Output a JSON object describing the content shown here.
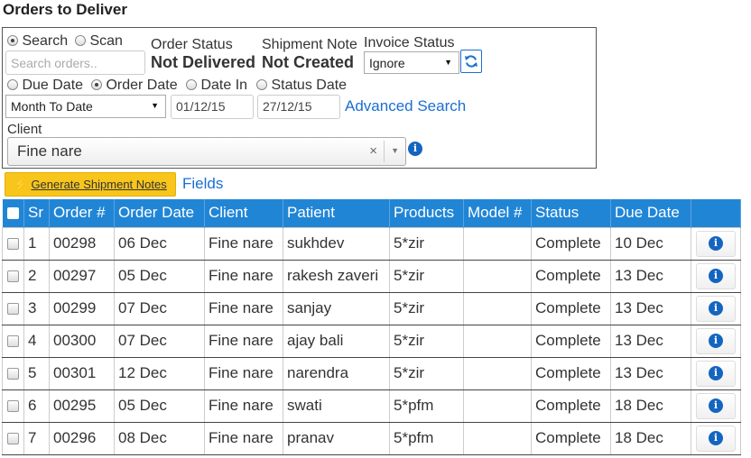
{
  "page": {
    "title": "Orders to Deliver"
  },
  "search_mode": {
    "search_label": "Search",
    "scan_label": "Scan",
    "selected": "search"
  },
  "search": {
    "placeholder": "Search orders..",
    "value": ""
  },
  "order_status": {
    "label": "Order Status",
    "value": "Not Delivered"
  },
  "shipment_note": {
    "label": "Shipment Note",
    "value": "Not Created"
  },
  "invoice_status": {
    "label": "Invoice Status",
    "selected": "Ignore"
  },
  "date_type": {
    "options": [
      "Due Date",
      "Order Date",
      "Date In",
      "Status Date"
    ],
    "selected": "Order Date",
    "labels": {
      "due": "Due Date",
      "order": "Order Date",
      "in": "Date In",
      "status": "Status Date"
    }
  },
  "date_range": {
    "selected": "Month To Date",
    "from": "01/12/15",
    "to": "27/12/15"
  },
  "advanced_search_label": "Advanced Search",
  "client": {
    "label": "Client",
    "value": "Fine nare"
  },
  "toolbar": {
    "generate_label": "Generate Shipment Notes",
    "fields_label": "Fields"
  },
  "table": {
    "columns": [
      "Sr",
      "Order #",
      "Order Date",
      "Client",
      "Patient",
      "Products",
      "Model #",
      "Status",
      "Due Date"
    ],
    "rows": [
      {
        "sr": "1",
        "order": "00298",
        "order_date": "06 Dec",
        "client": "Fine nare",
        "patient": "sukhdev",
        "products": "5*zir",
        "model": "",
        "status": "Complete",
        "due": "10 Dec"
      },
      {
        "sr": "2",
        "order": "00297",
        "order_date": "05 Dec",
        "client": "Fine nare",
        "patient": "rakesh zaveri",
        "products": "5*zir",
        "model": "",
        "status": "Complete",
        "due": "13 Dec"
      },
      {
        "sr": "3",
        "order": "00299",
        "order_date": "07 Dec",
        "client": "Fine nare",
        "patient": "sanjay",
        "products": "5*zir",
        "model": "",
        "status": "Complete",
        "due": "13 Dec"
      },
      {
        "sr": "4",
        "order": "00300",
        "order_date": "07 Dec",
        "client": "Fine nare",
        "patient": "ajay bali",
        "products": "5*zir",
        "model": "",
        "status": "Complete",
        "due": "13 Dec"
      },
      {
        "sr": "5",
        "order": "00301",
        "order_date": "12 Dec",
        "client": "Fine nare",
        "patient": "narendra",
        "products": "5*zir",
        "model": "",
        "status": "Complete",
        "due": "13 Dec"
      },
      {
        "sr": "6",
        "order": "00295",
        "order_date": "05 Dec",
        "client": "Fine nare",
        "patient": "swati",
        "products": "5*pfm",
        "model": "",
        "status": "Complete",
        "due": "18 Dec"
      },
      {
        "sr": "7",
        "order": "00296",
        "order_date": "08 Dec",
        "client": "Fine nare",
        "patient": "pranav",
        "products": "5*pfm",
        "model": "",
        "status": "Complete",
        "due": "18 Dec"
      }
    ]
  },
  "colors": {
    "accent": "#2185d6",
    "link": "#1a6fd1",
    "status_complete": "#8cc63f",
    "due_date": "#e00000",
    "button_yellow": "#f7c51b"
  },
  "icons": {
    "refresh": "refresh-icon",
    "info": "info-icon",
    "bolt": "bolt-icon",
    "clear": "clear-icon",
    "dropdown": "chevron-down-icon"
  }
}
